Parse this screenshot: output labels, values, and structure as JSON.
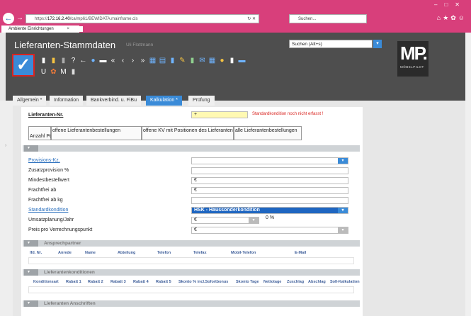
{
  "browser": {
    "url_prefix": "https://",
    "url_host": "172.16.2.40",
    "url_path": "/ca/mp61/BEWIDATA.mainframe.cls",
    "reload_symbol": "↻ ✕",
    "search_placeholder": "Suchen...",
    "tab_title": "Ambiente Einrichtungen",
    "tab_close": "×"
  },
  "header": {
    "title": "Lieferanten-Stammdaten",
    "user": "Uli Flottmann",
    "search": "Suchen (Alt+s)",
    "logo_mark": "MP.",
    "logo_sub": "MÖBELPILOT"
  },
  "toolbar": {
    "letters": [
      "U",
      "M"
    ]
  },
  "tabs": [
    "Allgemein *",
    "Information",
    "Bankverbind. u. FiBu",
    "Kalkulation *",
    "Prüfung"
  ],
  "form": {
    "lieferant_label": "Lieferanten-Nr.",
    "lieferant_value": "+",
    "error": "Standardkondition noch nicht erfasst !",
    "links": [
      "Anzahl Positionen",
      "offene Lieferantenbestellungen",
      "offene KV mit Positionen des Lieferanten",
      "alle Lieferantenbestellungen"
    ],
    "fields": [
      {
        "label": "Provisions-Kz.",
        "value": ""
      },
      {
        "label": "Zusatzprovision %",
        "value": ""
      },
      {
        "label": "Mindestbestellwert",
        "value": "€"
      },
      {
        "label": "Frachtfrei ab",
        "value": "€"
      },
      {
        "label": "Frachtfrei ab kg",
        "value": ""
      },
      {
        "label": "Standardkondition",
        "value": "HSK - Haussonderkondition"
      },
      {
        "label": "Umsatzplanung/Jahr",
        "value": "€",
        "extra": "0 %"
      },
      {
        "label": "Preis pro Verrechnungspunkt",
        "value": "€"
      }
    ]
  },
  "sections": {
    "ansprechpartner": {
      "title": "Ansprechpartner",
      "columns": [
        "lfd. Nr.",
        "Anrede",
        "Name",
        "Abteilung",
        "Telefon",
        "Telefax",
        "Mobil-Telefon",
        "E-Mail"
      ]
    },
    "konditionen": {
      "title": "Lieferantenkonditionen",
      "columns": [
        "Konditionsart",
        "Rabatt 1",
        "Rabatt 2",
        "Rabatt 3",
        "Rabatt 4",
        "Rabatt 5",
        "Skonto % incl.Sofortbonus",
        "Skonto Tage",
        "Nettotage",
        "Zuschlag",
        "Abschlag",
        "Soll-Kalkulation"
      ]
    },
    "anschriften": {
      "title": "Lieferanten Anschriften"
    }
  }
}
